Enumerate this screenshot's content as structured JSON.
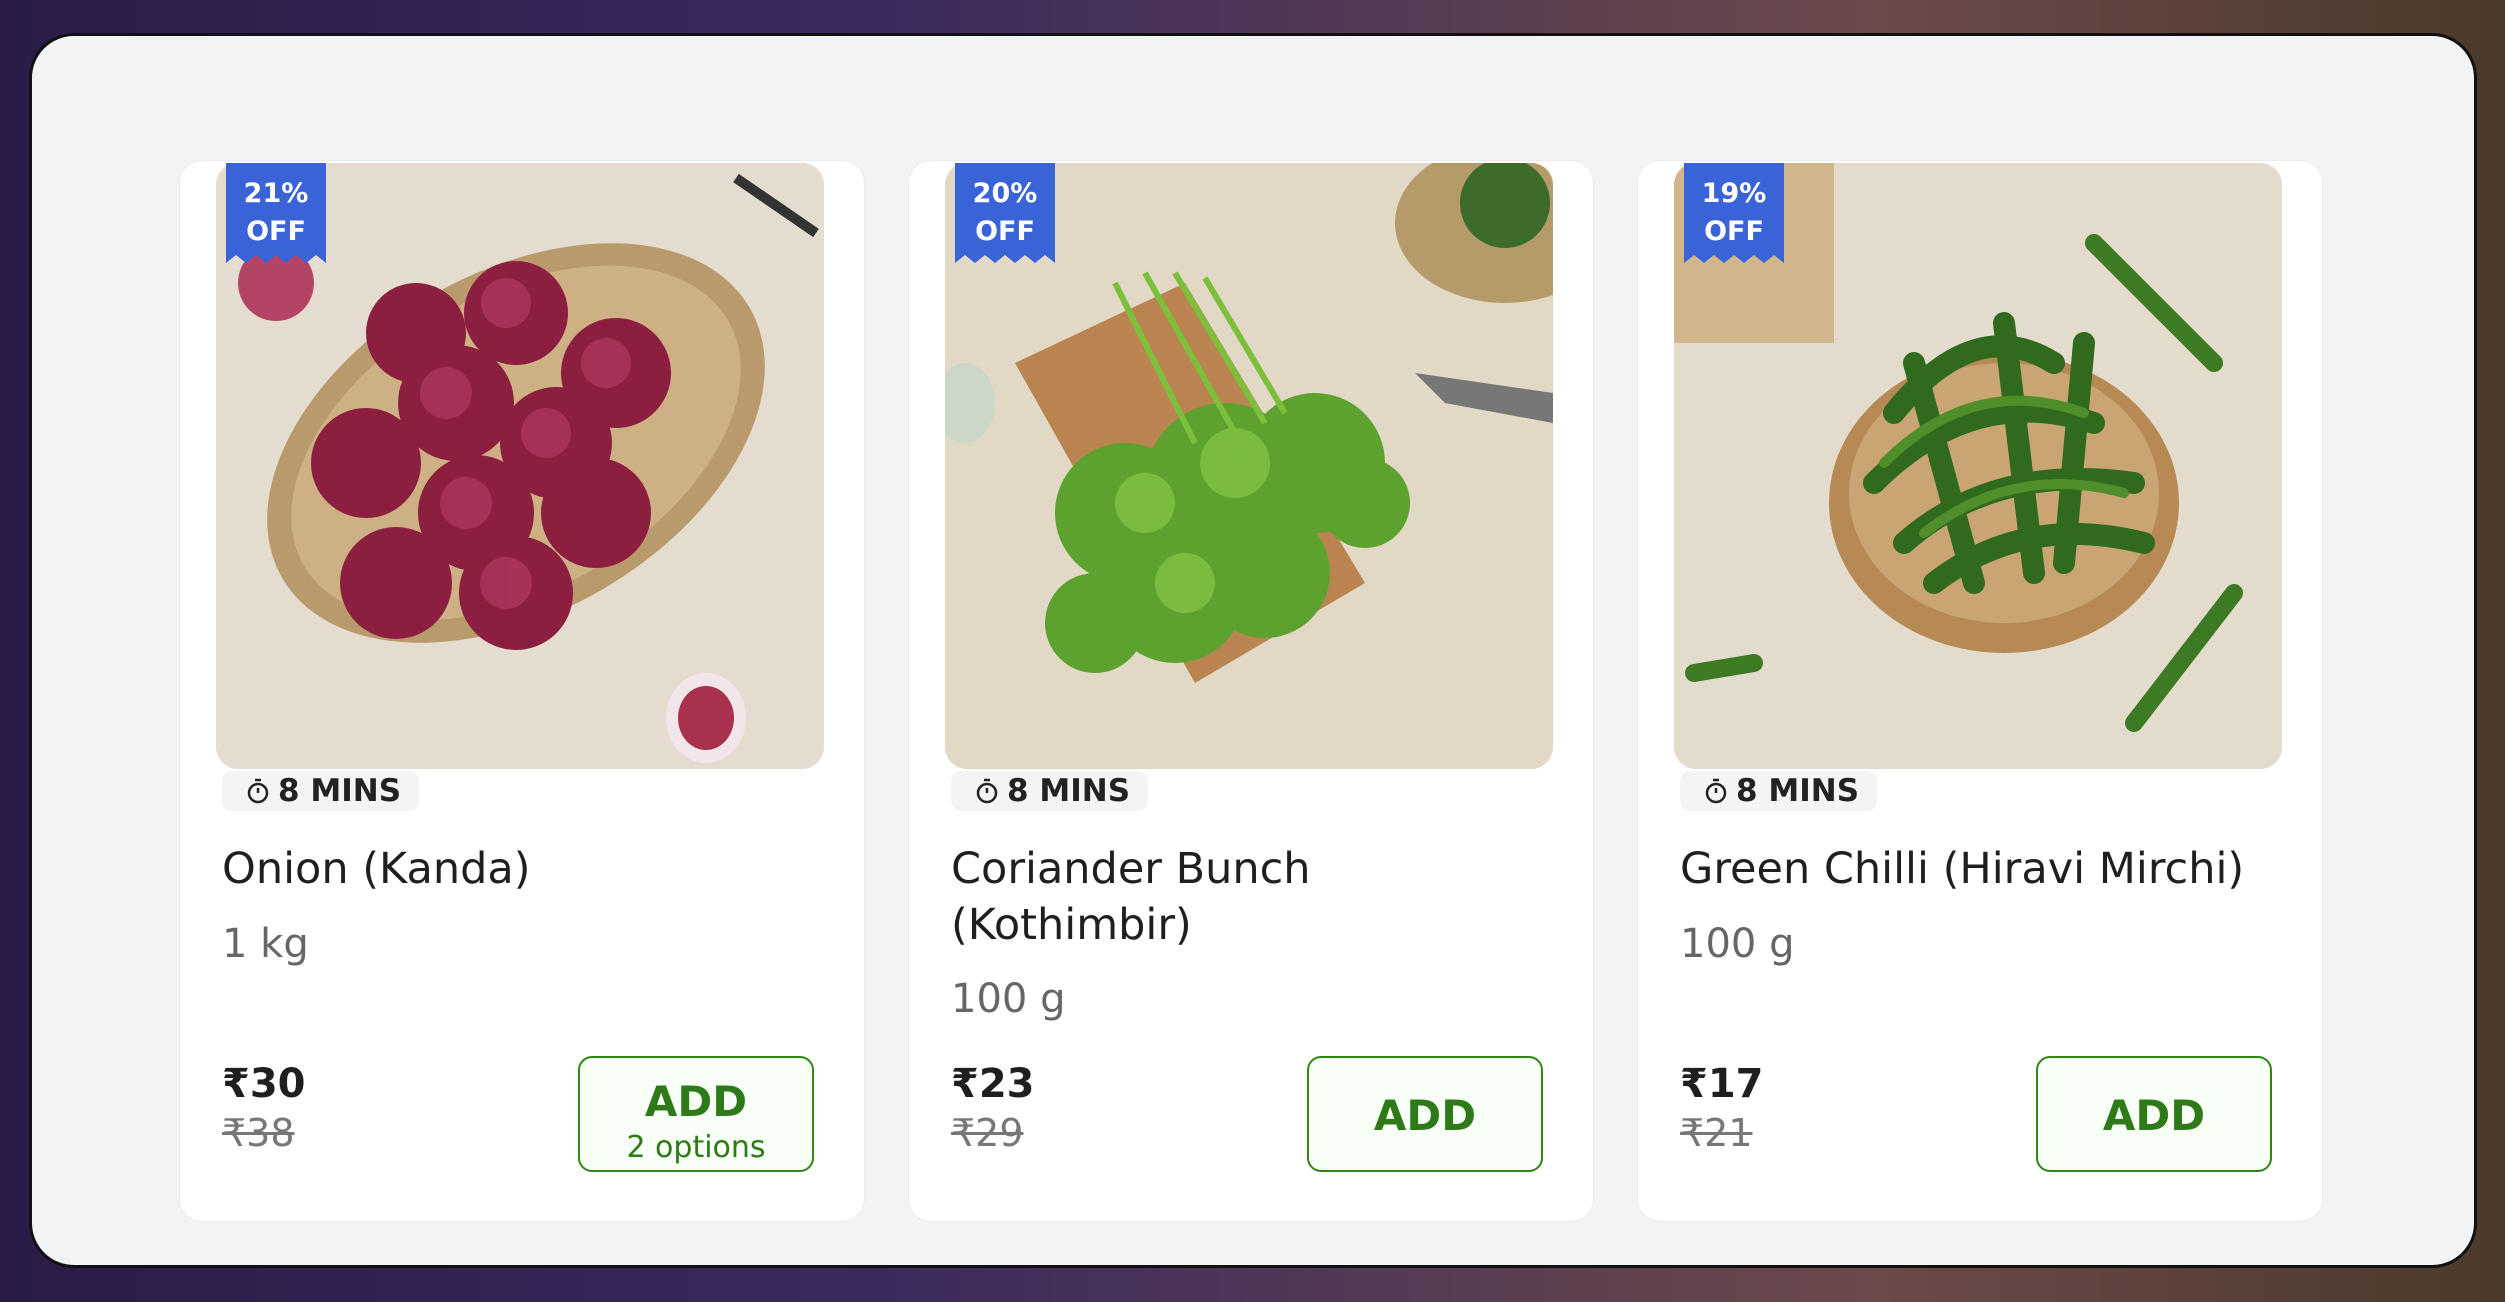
{
  "products": [
    {
      "discount_percent": "21%",
      "discount_off": "OFF",
      "eta": "8 MINS",
      "name": "Onion (Kanda)",
      "quantity": "1 kg",
      "price": "₹30",
      "mrp": "₹38",
      "add_label": "ADD",
      "add_options": "2 options",
      "image": "onions-in-basket"
    },
    {
      "discount_percent": "20%",
      "discount_off": "OFF",
      "eta": "8 MINS",
      "name": "Coriander Bunch (Kothimbir)",
      "quantity": "100 g",
      "price": "₹23",
      "mrp": "₹29",
      "add_label": "ADD",
      "image": "coriander-on-board"
    },
    {
      "discount_percent": "19%",
      "discount_off": "OFF",
      "eta": "8 MINS",
      "name": "Green Chilli (Hiravi Mirchi)",
      "quantity": "100 g",
      "price": "₹17",
      "mrp": "₹21",
      "add_label": "ADD",
      "image": "green-chillies-in-bowl"
    }
  ],
  "colors": {
    "badge": "#3b63d8",
    "add_border": "#318616",
    "add_text": "#2f7a18",
    "panel_bg": "#f2f3f5"
  }
}
